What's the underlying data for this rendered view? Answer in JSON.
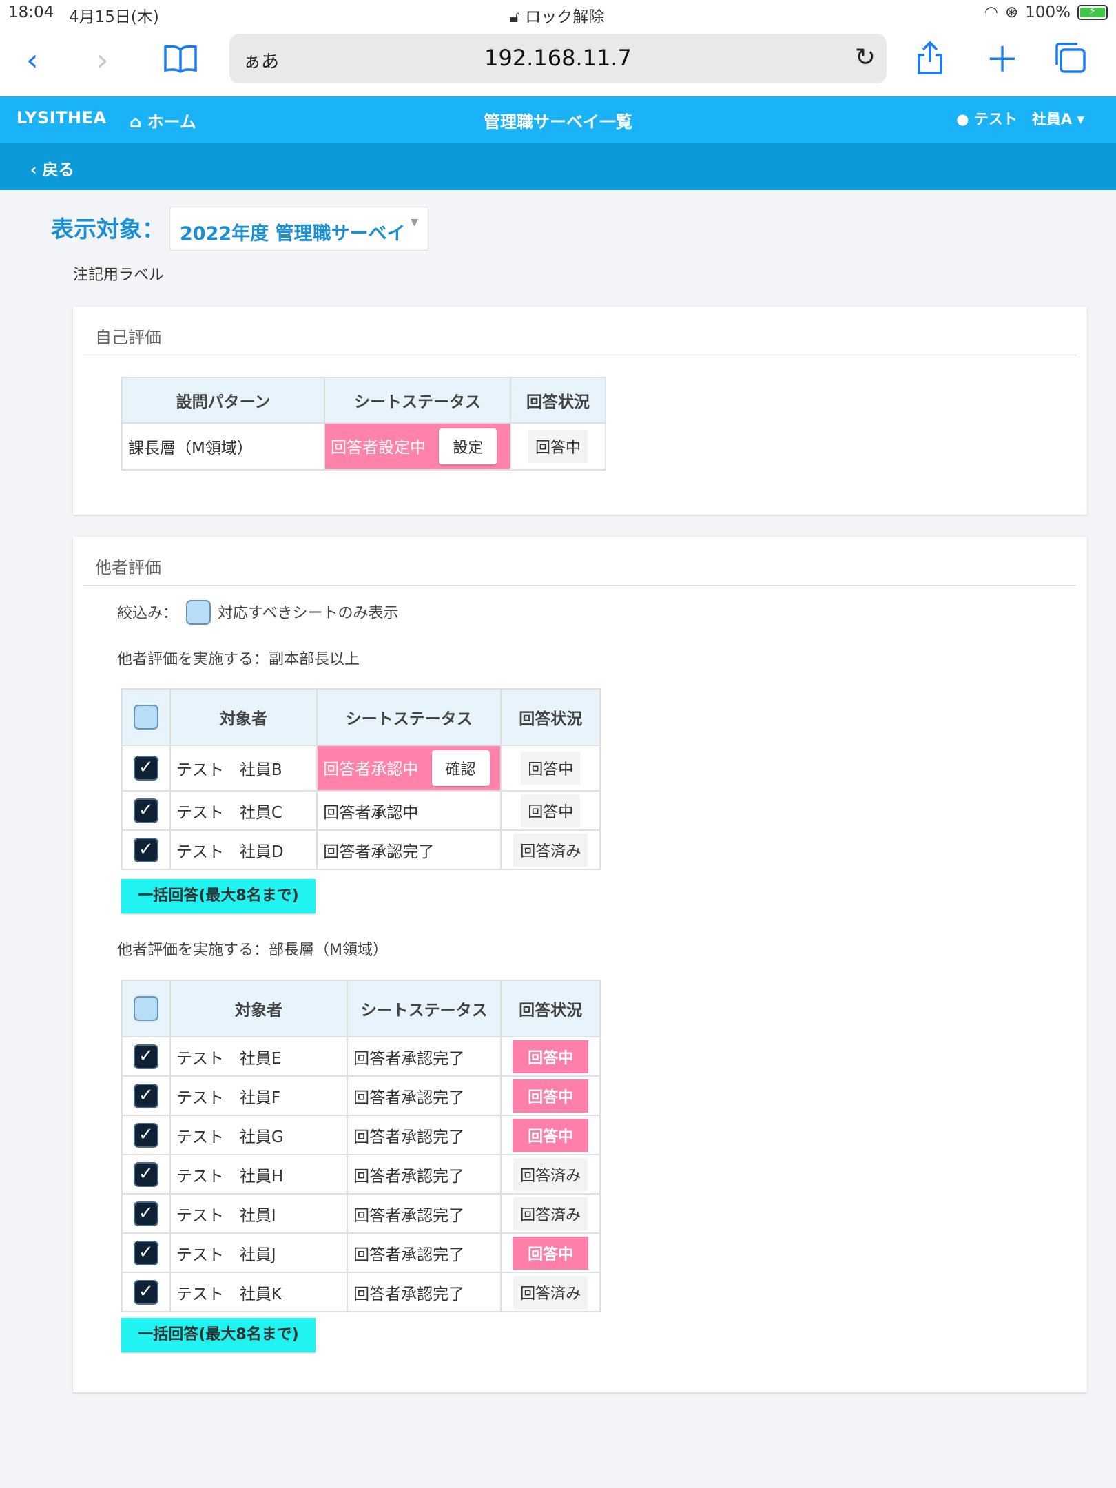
{
  "statusbar": {
    "time": "18:04",
    "date": "4月15日(木)",
    "lock_text": "ロック解除",
    "battery": "100%"
  },
  "browser": {
    "aa_label": "ぁあ",
    "url": "192.168.11.7"
  },
  "app": {
    "brand": "LYSITHEA",
    "home_label": "ホーム",
    "page_title": "管理職サーベイ一覧",
    "user_name": "テスト　社員A",
    "back_label": "戻る"
  },
  "target": {
    "label": "表示対象：",
    "selected": "2022年度 管理職サーベイ",
    "annotation": "注記用ラベル"
  },
  "self_eval": {
    "title": "自己評価",
    "headers": [
      "設問パターン",
      "シートステータス",
      "回答状況"
    ],
    "row": {
      "pattern": "課長層（M領域）",
      "sheet_status": "回答者設定中",
      "action_label": "設定",
      "answer_status": "回答中"
    }
  },
  "other_eval": {
    "title": "他者評価",
    "filter_label": "絞込み：",
    "filter_option": "対応すべきシートのみ表示",
    "group1": {
      "caption": "他者評価を実施する：副本部長以上",
      "headers": [
        "対象者",
        "シートステータス",
        "回答状況"
      ],
      "rows": [
        {
          "name": "テスト　社員B",
          "sheet_status": "回答者承認中",
          "action_label": "確認",
          "answer_status": "回答中"
        },
        {
          "name": "テスト　社員C",
          "sheet_status": "回答者承認中",
          "answer_status": "回答中"
        },
        {
          "name": "テスト　社員D",
          "sheet_status": "回答者承認完了",
          "answer_status": "回答済み"
        }
      ],
      "bulk_label": "一括回答(最大8名まで)"
    },
    "group2": {
      "caption": "他者評価を実施する：部長層（M領域）",
      "headers": [
        "対象者",
        "シートステータス",
        "回答状況"
      ],
      "rows": [
        {
          "name": "テスト　社員E",
          "sheet_status": "回答者承認完了",
          "answer_status": "回答中"
        },
        {
          "name": "テスト　社員F",
          "sheet_status": "回答者承認完了",
          "answer_status": "回答中"
        },
        {
          "name": "テスト　社員G",
          "sheet_status": "回答者承認完了",
          "answer_status": "回答中"
        },
        {
          "name": "テスト　社員H",
          "sheet_status": "回答者承認完了",
          "answer_status": "回答済み"
        },
        {
          "name": "テスト　社員I",
          "sheet_status": "回答者承認完了",
          "answer_status": "回答済み"
        },
        {
          "name": "テスト　社員J",
          "sheet_status": "回答者承認完了",
          "answer_status": "回答中"
        },
        {
          "name": "テスト　社員K",
          "sheet_status": "回答者承認完了",
          "answer_status": "回答済み"
        }
      ],
      "bulk_label": "一括回答(最大8名まで)"
    }
  },
  "colors": {
    "appbar": "#1ab3f8",
    "subbar": "#0c9ad8",
    "pink": "#ff82ab",
    "bulk_button": "#21f3f1",
    "accent_text": "#1a8fd6"
  }
}
